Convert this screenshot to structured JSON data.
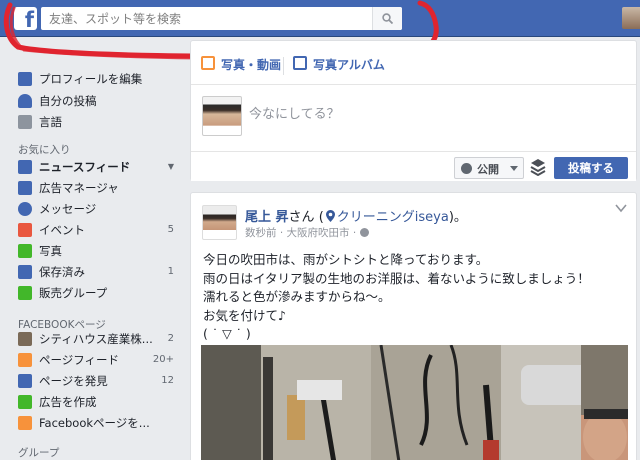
{
  "topbar": {
    "logo_letter": "f",
    "search_placeholder": "友達、スポット等を検索"
  },
  "sidebar": {
    "profile_items": [
      {
        "label": "プロフィールを編集",
        "icon": "pencil-icon"
      },
      {
        "label": "自分の投稿",
        "icon": "person-icon"
      },
      {
        "label": "言語",
        "icon": "language-icon"
      }
    ],
    "favorites_heading": "お気に入り",
    "favorites": [
      {
        "label": "ニュースフィード",
        "icon": "news-feed-icon",
        "count": ""
      },
      {
        "label": "広告マネージャ",
        "icon": "ads-manager-icon",
        "count": ""
      },
      {
        "label": "メッセージ",
        "icon": "messages-icon",
        "count": ""
      },
      {
        "label": "イベント",
        "icon": "calendar-icon",
        "count": "5"
      },
      {
        "label": "写真",
        "icon": "photos-icon",
        "count": ""
      },
      {
        "label": "保存済み",
        "icon": "bookmark-icon",
        "count": "1"
      },
      {
        "label": "販売グループ",
        "icon": "tag-icon",
        "count": ""
      }
    ],
    "pages_heading": "FACEBOOKページ",
    "pages": [
      {
        "label": "シティハウス産業株...",
        "icon": "page-icon",
        "count": "2"
      },
      {
        "label": "ページフィード",
        "icon": "megaphone-icon",
        "count": "20+"
      },
      {
        "label": "ページを発見",
        "icon": "thumbs-up-icon",
        "count": "12"
      },
      {
        "label": "広告を作成",
        "icon": "plus-icon",
        "count": ""
      },
      {
        "label": "Facebookページを...",
        "icon": "flag-plus-icon",
        "count": ""
      }
    ],
    "groups_heading": "グループ"
  },
  "composer": {
    "tabs": [
      {
        "label": "写真・動画",
        "icon": "photo-video-icon"
      },
      {
        "label": "写真アルバム",
        "icon": "album-icon"
      }
    ],
    "prompt": "今なにしてる？",
    "privacy_label": "公開",
    "post_button": "投稿する"
  },
  "post": {
    "author": "尾上 昇",
    "honorific": "さん",
    "place": "クリーニングiseya",
    "suffix": "。",
    "meta": "数秒前 · 大阪府吹田市 · ",
    "lines": [
      "今日の吹田市は、雨がシトシトと降っております。",
      "雨の日はイタリア製の生地のお洋服は、着ないように致しましょう！",
      "濡れると色が滲みますからね〜。",
      "お気を付けて♪",
      "( ˙ ▽ ˙ )"
    ]
  },
  "colors": {
    "brand_blue": "#4267b2",
    "link_blue": "#365899",
    "annotation_red": "#e0242f"
  }
}
